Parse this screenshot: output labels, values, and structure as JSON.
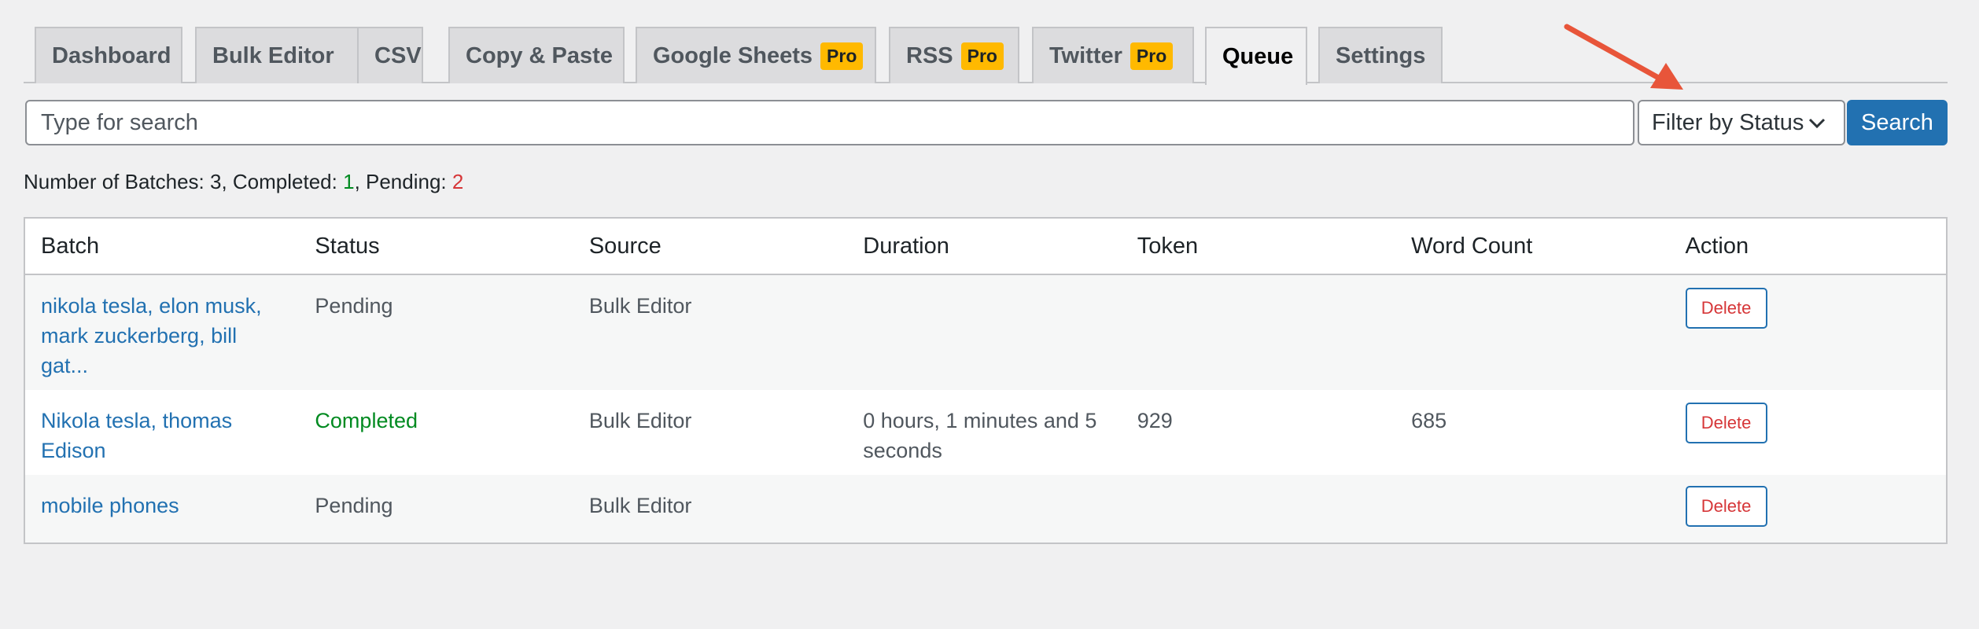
{
  "tabs": [
    {
      "label": "Dashboard",
      "pro": ""
    },
    {
      "label": "Bulk Editor",
      "pro": ""
    },
    {
      "label": "CSV",
      "pro": ""
    },
    {
      "label": "Copy & Paste",
      "pro": ""
    },
    {
      "label": "Google Sheets",
      "pro": "Pro"
    },
    {
      "label": "RSS",
      "pro": "Pro"
    },
    {
      "label": "Twitter",
      "pro": "Pro"
    },
    {
      "label": "Queue",
      "pro": ""
    },
    {
      "label": "Settings",
      "pro": ""
    }
  ],
  "active_tab": "Queue",
  "search": {
    "placeholder": "Type for search",
    "value": "",
    "button_label": "Search"
  },
  "filter": {
    "selected": "Filter by Status"
  },
  "summary": {
    "prefix": "Number of Batches: 3, Completed: ",
    "completed": "1",
    "middle": ", Pending: ",
    "pending": "2"
  },
  "table": {
    "headers": [
      "Batch",
      "Status",
      "Source",
      "Duration",
      "Token",
      "Word Count",
      "Action"
    ],
    "rows": [
      {
        "batch": "nikola tesla, elon musk, mark zuckerberg, bill gat...",
        "status": "Pending",
        "source": "Bulk Editor",
        "duration": "",
        "token": "",
        "word_count": "",
        "action": "Delete"
      },
      {
        "batch": "Nikola tesla, thomas Edison",
        "status": "Completed",
        "source": "Bulk Editor",
        "duration": "0 hours, 1 minutes and 5 seconds",
        "token": "929",
        "word_count": "685",
        "action": "Delete"
      },
      {
        "batch": "mobile phones",
        "status": "Pending",
        "source": "Bulk Editor",
        "duration": "",
        "token": "",
        "word_count": "",
        "action": "Delete"
      }
    ]
  },
  "colors": {
    "accent": "#2271b1",
    "pro_badge": "#ffb900",
    "completed": "#008a20",
    "pending_count": "#d63638",
    "arrow": "#e8553a"
  },
  "icons": {
    "filter_chevron": "chevron-down-icon",
    "annotation": "arrow-icon"
  }
}
